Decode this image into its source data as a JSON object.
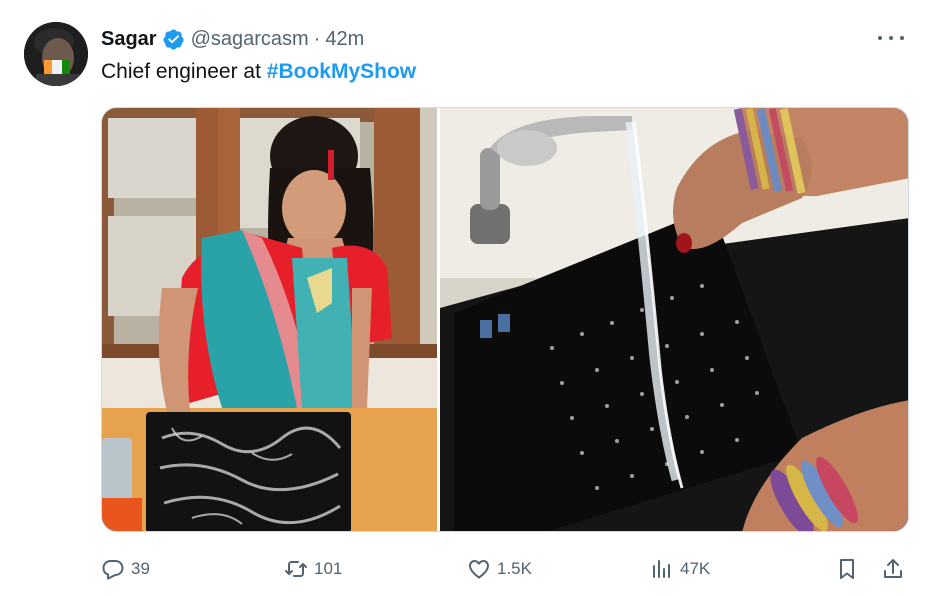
{
  "tweet": {
    "display_name": "Sagar",
    "handle": "@sagarcasm",
    "separator": "·",
    "time": "42m",
    "text_prefix": "Chief engineer at ",
    "hashtag": "#BookMyShow",
    "verified_color": "#1d9bf0",
    "hashtag_color": "#1d9bf0"
  },
  "media": {
    "panels": 2
  },
  "actions": {
    "replies": "39",
    "retweets": "101",
    "likes": "1.5K",
    "views": "47K"
  },
  "icons": {
    "reply": "reply-icon",
    "retweet": "retweet-icon",
    "like": "heart-icon",
    "views": "views-icon",
    "bookmark": "bookmark-icon",
    "share": "share-icon",
    "more": "more-icon",
    "verified": "verified-badge-icon"
  }
}
